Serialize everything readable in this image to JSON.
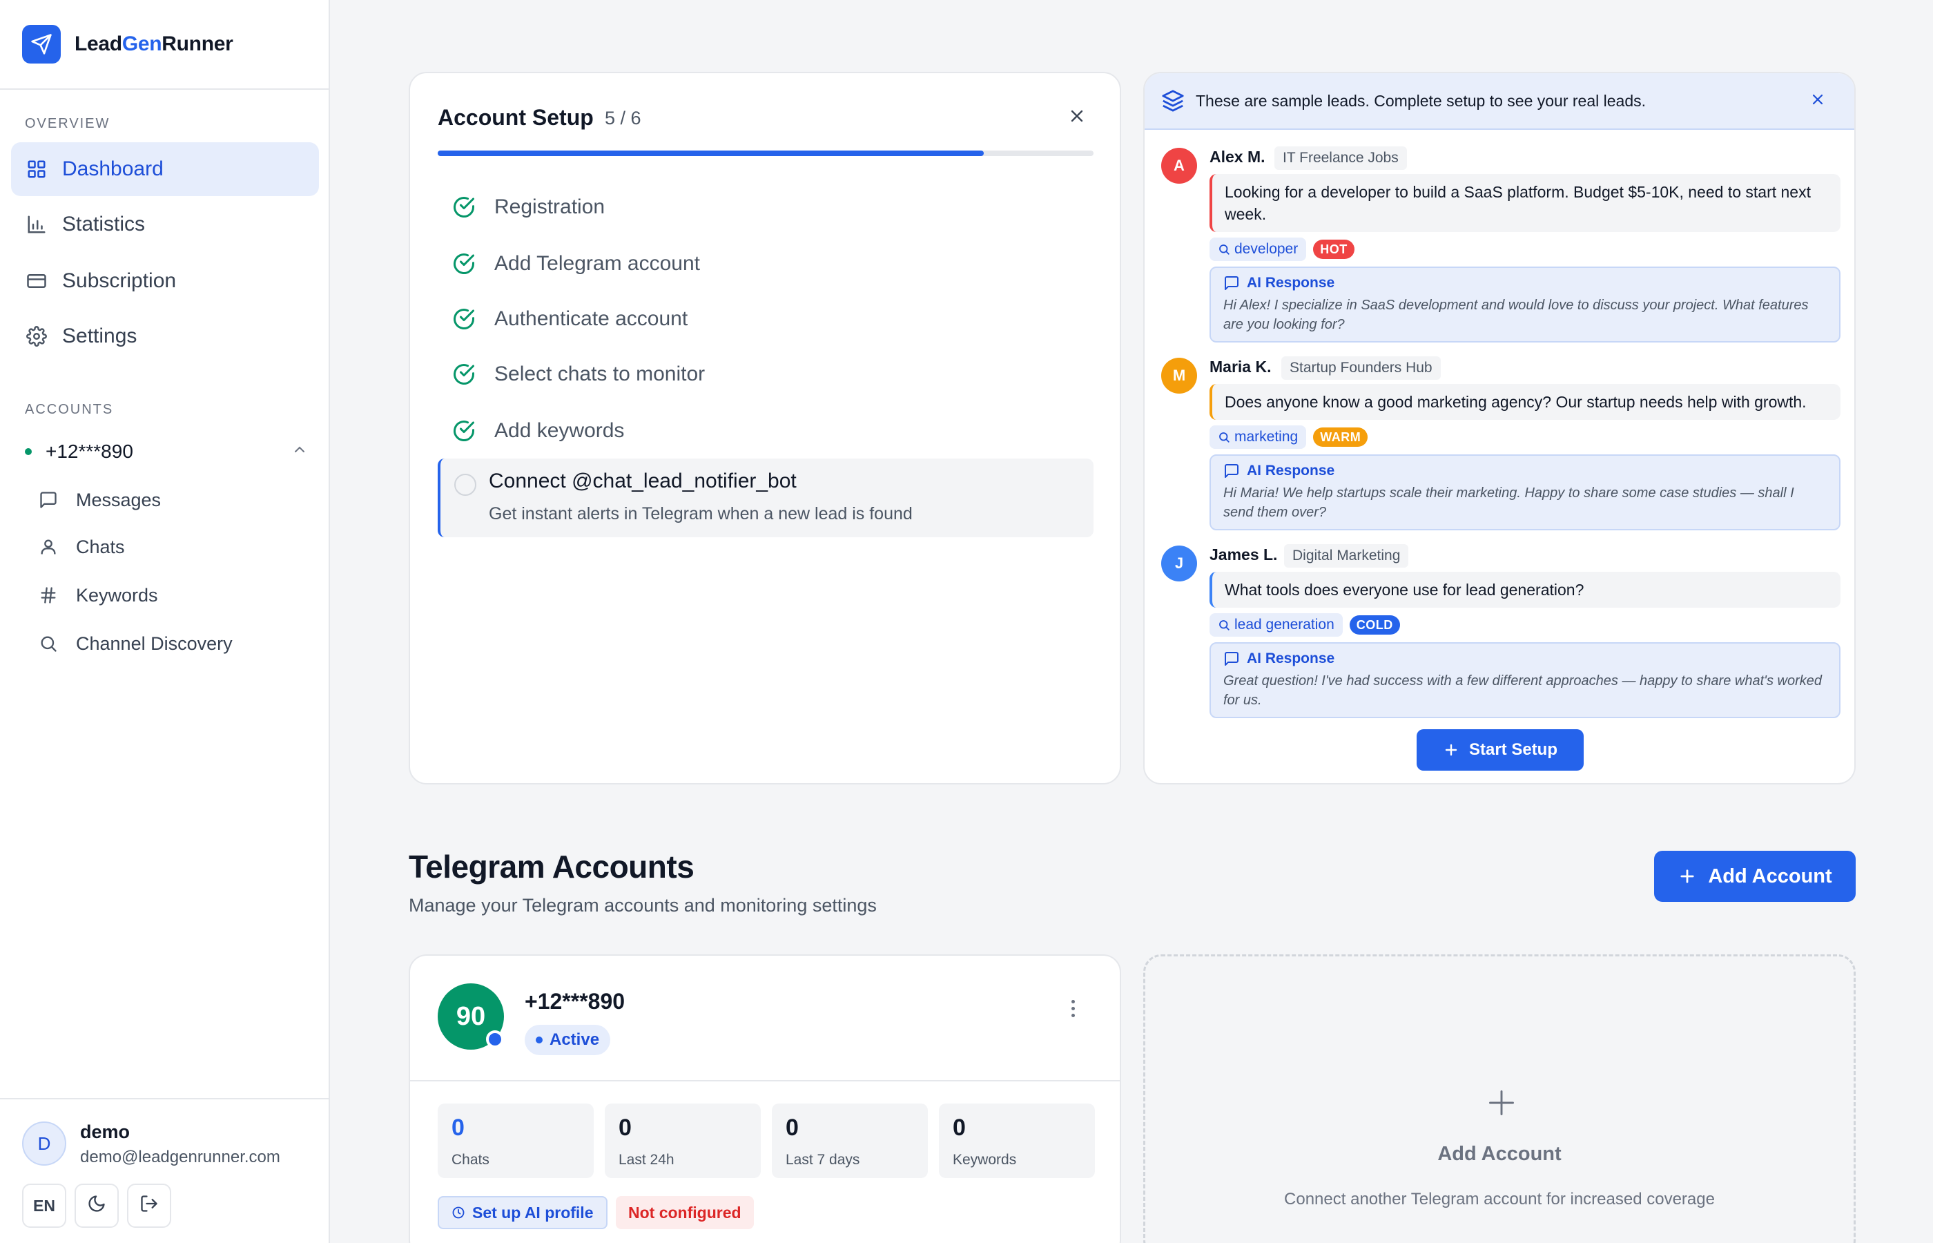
{
  "brand": {
    "name_part1": "Lead",
    "name_part2": "Gen",
    "name_part3": "Runner"
  },
  "sidebar": {
    "overview_label": "OVERVIEW",
    "nav": [
      {
        "label": "Dashboard",
        "icon": "grid-icon",
        "active": true
      },
      {
        "label": "Statistics",
        "icon": "bar-chart-icon"
      },
      {
        "label": "Subscription",
        "icon": "credit-card-icon"
      },
      {
        "label": "Settings",
        "icon": "gear-icon"
      }
    ],
    "accounts_label": "ACCOUNTS",
    "account": {
      "phone": "+12***890",
      "expanded": true
    },
    "sub_items": [
      {
        "label": "Messages",
        "icon": "message-icon"
      },
      {
        "label": "Chats",
        "icon": "user-icon"
      },
      {
        "label": "Keywords",
        "icon": "hash-icon"
      },
      {
        "label": "Channel Discovery",
        "icon": "search-icon"
      }
    ],
    "user": {
      "initial": "D",
      "name": "demo",
      "email": "demo@leadgenrunner.com",
      "lang": "EN"
    }
  },
  "setup": {
    "title": "Account Setup",
    "count": "5 / 6",
    "progress_fraction": 0.833,
    "steps": [
      {
        "label": "Registration",
        "done": true
      },
      {
        "label": "Add Telegram account",
        "done": true
      },
      {
        "label": "Authenticate account",
        "done": true
      },
      {
        "label": "Select chats to monitor",
        "done": true
      },
      {
        "label": "Add keywords",
        "done": true
      }
    ],
    "active_step": {
      "label": "Connect @chat_lead_notifier_bot",
      "description": "Get instant alerts in Telegram when a new lead is found"
    }
  },
  "leads": {
    "banner": "These are sample leads. Complete setup to see your real leads.",
    "items": [
      {
        "initial": "A",
        "name": "Alex M.",
        "channel": "IT Freelance Jobs",
        "avatar_color": "#ef4444",
        "border_color": "#ef4444",
        "message": "Looking for a developer to build a SaaS platform. Budget $5-10K, need to start next week.",
        "keyword": "developer",
        "temperature": "HOT",
        "temp_color": "#ef4444",
        "ai_label": "AI Response",
        "ai_text": "Hi Alex! I specialize in SaaS development and would love to discuss your project. What features are you looking for?"
      },
      {
        "initial": "M",
        "name": "Maria K.",
        "channel": "Startup Founders Hub",
        "avatar_color": "#f59e0b",
        "border_color": "#f59e0b",
        "message": "Does anyone know a good marketing agency? Our startup needs help with growth.",
        "keyword": "marketing",
        "temperature": "WARM",
        "temp_color": "#f59e0b",
        "ai_label": "AI Response",
        "ai_text": "Hi Maria! We help startups scale their marketing. Happy to share some case studies — shall I send them over?"
      },
      {
        "initial": "J",
        "name": "James L.",
        "channel": "Digital Marketing",
        "avatar_color": "#3b82f6",
        "border_color": "#3b82f6",
        "message": "What tools does everyone use for lead generation?",
        "keyword": "lead generation",
        "temperature": "COLD",
        "temp_color": "#2563eb",
        "ai_label": "AI Response",
        "ai_text": "Great question! I've had success with a few different approaches — happy to share what's worked for us."
      }
    ],
    "start_button": "Start Setup"
  },
  "accounts_section": {
    "title": "Telegram Accounts",
    "subtitle": "Manage your Telegram accounts and monitoring settings",
    "add_button": "Add Account"
  },
  "account_card": {
    "avatar_text": "90",
    "phone": "+12***890",
    "status": "Active",
    "stats": [
      {
        "value": "0",
        "label": "Chats"
      },
      {
        "value": "0",
        "label": "Last 24h"
      },
      {
        "value": "0",
        "label": "Last 7 days"
      },
      {
        "value": "0",
        "label": "Keywords"
      }
    ],
    "ai_profile_button": "Set up AI profile",
    "ai_profile_status": "Not configured"
  },
  "add_card": {
    "title": "Add Account",
    "description": "Connect another Telegram account for increased coverage"
  }
}
